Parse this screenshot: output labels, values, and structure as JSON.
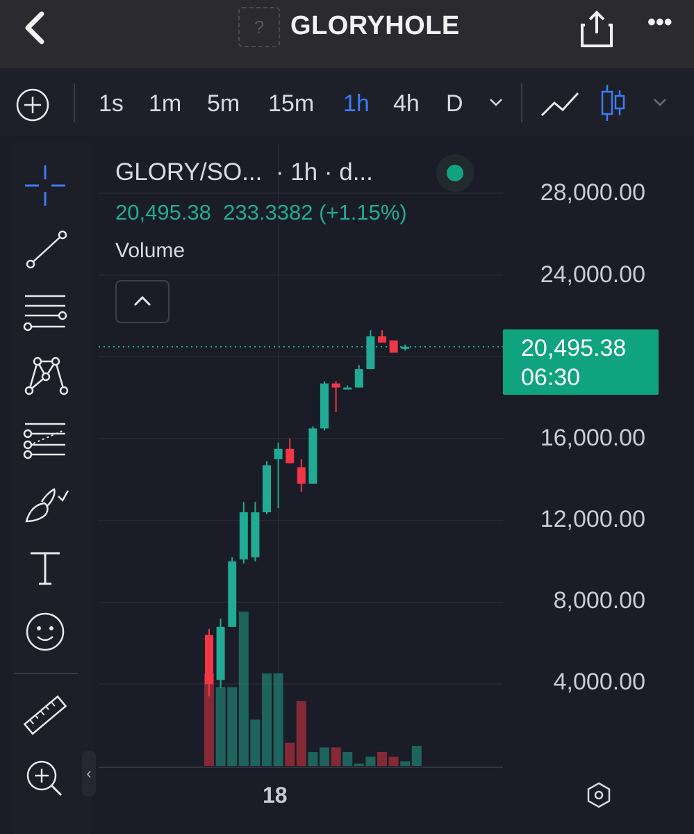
{
  "header": {
    "title": "GLORYHOLE",
    "logo_placeholder": "?",
    "more_label": "•••"
  },
  "toolbar": {
    "timeframes": [
      "1s",
      "1m",
      "5m",
      "15m",
      "1h",
      "4h",
      "D"
    ],
    "active_timeframe": "1h"
  },
  "chart": {
    "symbol": "GLORY/SO...",
    "interval_info": "· 1h · d...",
    "last_price": "20,495.38",
    "change": "233.3382",
    "change_pct": "(+1.15%)",
    "volume_label": "Volume",
    "price_labels": [
      "28,000.00",
      "24,000.00",
      "16,000.00",
      "12,000.00",
      "8,000.00",
      "4,000.00"
    ],
    "last_price_tag": "20,495.38",
    "countdown": "06:30",
    "date_label": "18"
  },
  "colors": {
    "up": "#22ab94",
    "down": "#f23645",
    "accent": "#3d7bf7",
    "last_price_bg": "#10a37f"
  },
  "chart_data": {
    "type": "candlestick",
    "interval": "1h",
    "ylim": [
      0,
      30000
    ],
    "candles": [
      {
        "o": 6400,
        "h": 6700,
        "l": 3400,
        "c": 4000
      },
      {
        "o": 4200,
        "h": 7200,
        "l": 3800,
        "c": 6800
      },
      {
        "o": 6800,
        "h": 10200,
        "l": 6800,
        "c": 10000
      },
      {
        "o": 10100,
        "h": 12900,
        "l": 9900,
        "c": 12400
      },
      {
        "o": 10200,
        "h": 12900,
        "l": 10000,
        "c": 12400
      },
      {
        "o": 12400,
        "h": 14900,
        "l": 12300,
        "c": 14700
      },
      {
        "o": 15000,
        "h": 15800,
        "l": 12600,
        "c": 15500
      },
      {
        "o": 15500,
        "h": 16000,
        "l": 14800,
        "c": 14800
      },
      {
        "o": 14600,
        "h": 15000,
        "l": 13400,
        "c": 13800
      },
      {
        "o": 13800,
        "h": 16600,
        "l": 13800,
        "c": 16500
      },
      {
        "o": 16500,
        "h": 18800,
        "l": 16400,
        "c": 18700
      },
      {
        "o": 18700,
        "h": 18800,
        "l": 17300,
        "c": 18500
      },
      {
        "o": 18500,
        "h": 18600,
        "l": 18500,
        "c": 18500
      },
      {
        "o": 18500,
        "h": 19600,
        "l": 18500,
        "c": 19400
      },
      {
        "o": 19400,
        "h": 21300,
        "l": 19400,
        "c": 21000
      },
      {
        "o": 21000,
        "h": 21300,
        "l": 20700,
        "c": 20700
      },
      {
        "o": 20800,
        "h": 20800,
        "l": 20400,
        "c": 20200
      },
      {
        "o": 20400,
        "h": 20600,
        "l": 20300,
        "c": 20495
      }
    ],
    "volume_relative": [
      0.6,
      0.51,
      0.51,
      1.0,
      0.3,
      0.6,
      0.6,
      0.15,
      0.42,
      0.09,
      0.12,
      0.12,
      0.09,
      0.015,
      0.06,
      0.09,
      0.06,
      0.03,
      0.13
    ],
    "last_price": 20495.38
  }
}
